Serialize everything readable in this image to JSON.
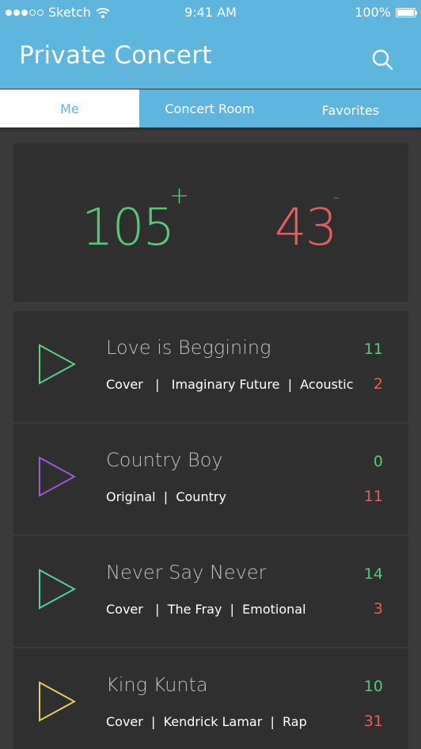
{
  "status_bar": {
    "carrier": "Sketch",
    "time": "9:41 AM",
    "battery": "100%"
  },
  "header": {
    "title": "Private Concert"
  },
  "tabs": [
    {
      "label": "Me",
      "active": true
    },
    {
      "label": "Concert Room",
      "active": false
    },
    {
      "label": "Favorites",
      "active": false
    }
  ],
  "scores": {
    "positive": "105",
    "positive_symbol": "+",
    "negative": "43",
    "negative_symbol": "-"
  },
  "songs": [
    {
      "title": "Love is Beggining",
      "tags": [
        "Cover",
        "Imaginary Future",
        "Acoustic"
      ],
      "up": "11",
      "down": "2",
      "play_color": "#5ad28a"
    },
    {
      "title": "Country Boy",
      "tags": [
        "Original",
        "Country"
      ],
      "up": "0",
      "down": "11",
      "play_color": "#9a5be0"
    },
    {
      "title": "Never Say Never",
      "tags": [
        "Cover",
        "The Fray",
        "Emotional"
      ],
      "up": "14",
      "down": "3",
      "play_color": "#4ed1b0"
    },
    {
      "title": "King Kunta",
      "tags": [
        "Cover",
        "Kendrick Lamar",
        "Rap"
      ],
      "up": "10",
      "down": "31",
      "play_color": "#e4cf5a"
    }
  ],
  "colors": {
    "accent": "#5eb6df",
    "positive": "#55c97a",
    "negative": "#e35f5f",
    "card": "#2f2f2f",
    "background": "#3a3a3a"
  }
}
